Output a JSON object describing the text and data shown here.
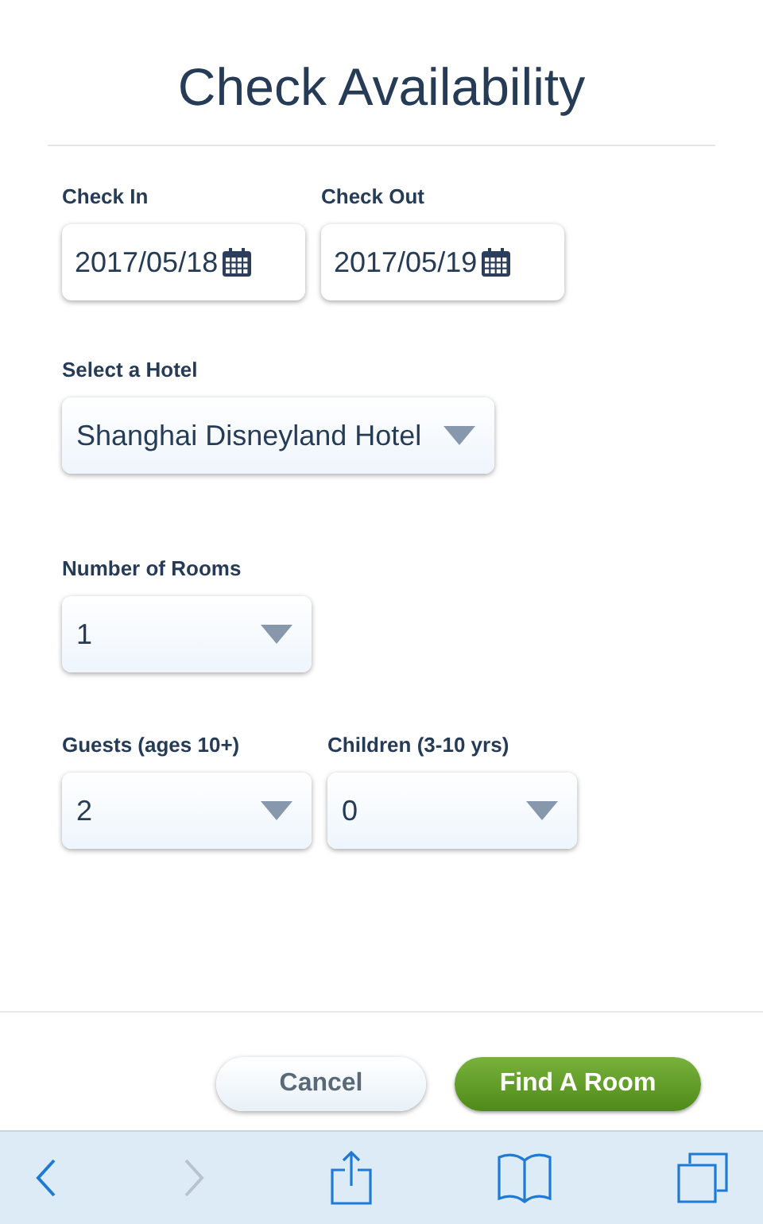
{
  "title": "Check Availability",
  "rows": [
    {
      "fields": [
        {
          "kind": "date",
          "label": "Check In",
          "value": "2017/05/18"
        },
        {
          "kind": "date",
          "label": "Check Out",
          "value": "2017/05/19"
        }
      ]
    },
    {
      "fields": [
        {
          "kind": "select",
          "label": "Select a Hotel",
          "value": "Shanghai Disneyland Hotel"
        }
      ]
    },
    {
      "fields": [
        {
          "kind": "select",
          "label": "Number of Rooms",
          "value": "1"
        }
      ]
    },
    {
      "fields": [
        {
          "kind": "select",
          "label": "Guests (ages 10+)",
          "value": "2"
        },
        {
          "kind": "select",
          "label": "Children (3-10 yrs)",
          "value": "0"
        }
      ]
    }
  ],
  "buttons": [
    {
      "kind": "secondary",
      "label": "Cancel"
    },
    {
      "kind": "primary",
      "label": "Find A Room"
    }
  ],
  "toolbar": [
    {
      "kind": "back",
      "disabled": false
    },
    {
      "kind": "forward",
      "disabled": true
    },
    {
      "kind": "share",
      "disabled": false
    },
    {
      "kind": "bookmarks",
      "disabled": false
    },
    {
      "kind": "tabs",
      "disabled": false
    }
  ]
}
